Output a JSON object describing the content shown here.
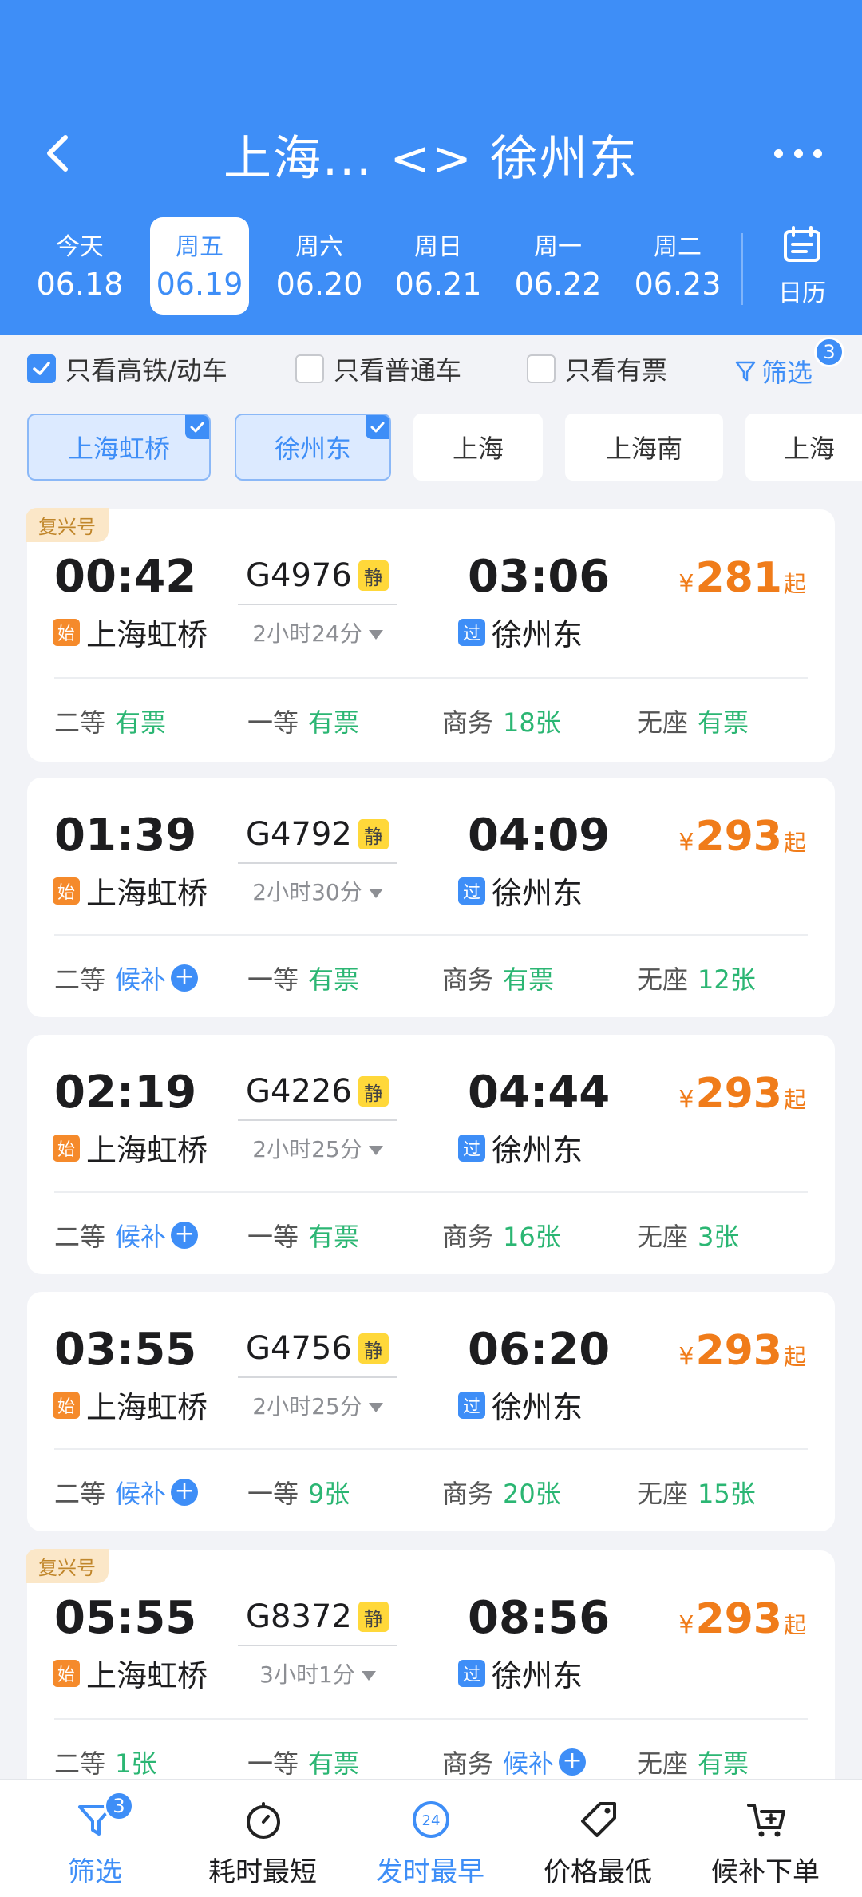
{
  "header": {
    "title": "上海... <> 徐州东",
    "calendar_label": "日历"
  },
  "dates": [
    {
      "week": "今天",
      "date": "06.18"
    },
    {
      "week": "周五",
      "date": "06.19"
    },
    {
      "week": "周六",
      "date": "06.20"
    },
    {
      "week": "周日",
      "date": "06.21"
    },
    {
      "week": "周一",
      "date": "06.22"
    },
    {
      "week": "周二",
      "date": "06.23"
    }
  ],
  "filters": {
    "high_speed": "只看高铁/动车",
    "normal": "只看普通车",
    "available": "只看有票",
    "filter": "筛选",
    "filter_count": "3"
  },
  "stations": [
    "上海虹桥",
    "徐州东",
    "上海",
    "上海南",
    "上海"
  ],
  "trains": [
    {
      "tag": "复兴号",
      "dep_time": "00:42",
      "train_no": "G4976",
      "quiet": "静",
      "arr_time": "03:06",
      "duration": "2小时24分",
      "dep_badge": "始",
      "dep_station": "上海虹桥",
      "arr_badge": "过",
      "arr_station": "徐州东",
      "yen": "¥",
      "price": "281",
      "price_suffix": "起",
      "seats": [
        {
          "cls": "二等",
          "val": "有票"
        },
        {
          "cls": "一等",
          "val": "有票"
        },
        {
          "cls": "商务",
          "val": "18张"
        },
        {
          "cls": "无座",
          "val": "有票"
        }
      ]
    },
    {
      "tag": "",
      "dep_time": "01:39",
      "train_no": "G4792",
      "quiet": "静",
      "arr_time": "04:09",
      "duration": "2小时30分",
      "dep_badge": "始",
      "dep_station": "上海虹桥",
      "arr_badge": "过",
      "arr_station": "徐州东",
      "yen": "¥",
      "price": "293",
      "price_suffix": "起",
      "seats": [
        {
          "cls": "二等",
          "val": "候补"
        },
        {
          "cls": "一等",
          "val": "有票"
        },
        {
          "cls": "商务",
          "val": "有票"
        },
        {
          "cls": "无座",
          "val": "12张"
        }
      ]
    },
    {
      "tag": "",
      "dep_time": "02:19",
      "train_no": "G4226",
      "quiet": "静",
      "arr_time": "04:44",
      "duration": "2小时25分",
      "dep_badge": "始",
      "dep_station": "上海虹桥",
      "arr_badge": "过",
      "arr_station": "徐州东",
      "yen": "¥",
      "price": "293",
      "price_suffix": "起",
      "seats": [
        {
          "cls": "二等",
          "val": "候补"
        },
        {
          "cls": "一等",
          "val": "有票"
        },
        {
          "cls": "商务",
          "val": "16张"
        },
        {
          "cls": "无座",
          "val": "3张"
        }
      ]
    },
    {
      "tag": "",
      "dep_time": "03:55",
      "train_no": "G4756",
      "quiet": "静",
      "arr_time": "06:20",
      "duration": "2小时25分",
      "dep_badge": "始",
      "dep_station": "上海虹桥",
      "arr_badge": "过",
      "arr_station": "徐州东",
      "yen": "¥",
      "price": "293",
      "price_suffix": "起",
      "seats": [
        {
          "cls": "二等",
          "val": "候补"
        },
        {
          "cls": "一等",
          "val": "9张"
        },
        {
          "cls": "商务",
          "val": "20张"
        },
        {
          "cls": "无座",
          "val": "15张"
        }
      ]
    },
    {
      "tag": "复兴号",
      "dep_time": "05:55",
      "train_no": "G8372",
      "quiet": "静",
      "arr_time": "08:56",
      "duration": "3小时1分",
      "dep_badge": "始",
      "dep_station": "上海虹桥",
      "arr_badge": "过",
      "arr_station": "徐州东",
      "yen": "¥",
      "price": "293",
      "price_suffix": "起",
      "seats": [
        {
          "cls": "二等",
          "val": "1张"
        },
        {
          "cls": "一等",
          "val": "有票"
        },
        {
          "cls": "商务",
          "val": "候补"
        },
        {
          "cls": "无座",
          "val": "有票"
        }
      ]
    }
  ],
  "bottom_tabs": [
    {
      "label": "筛选",
      "icon": "funnel-icon",
      "badge": "3"
    },
    {
      "label": "耗时最短",
      "icon": "stopwatch-icon"
    },
    {
      "label": "发时最早",
      "icon": "clock-24-icon",
      "icon_text": "24"
    },
    {
      "label": "价格最低",
      "icon": "price-tag-icon"
    },
    {
      "label": "候补下单",
      "icon": "cart-add-icon"
    }
  ],
  "colors": {
    "primary": "#3e8ef7",
    "price": "#f07c1a",
    "available": "#2bb673",
    "background": "#f2f3f7"
  }
}
